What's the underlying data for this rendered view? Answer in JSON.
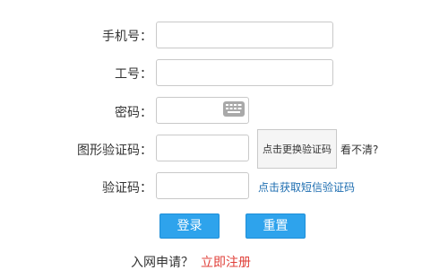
{
  "form": {
    "phone_label": "手机号：",
    "phone_value": "",
    "employee_id_label": "工号：",
    "employee_id_value": "",
    "password_label": "密码：",
    "password_value": "",
    "captcha_label": "图形验证码：",
    "captcha_value": "",
    "captcha_image_text": "点击更换验证码",
    "captcha_refresh_text": "看不清?",
    "sms_label": "验证码：",
    "sms_value": "",
    "sms_link_text": "点击获取短信验证码"
  },
  "buttons": {
    "login_label": "登录",
    "reset_label": "重置"
  },
  "footer": {
    "apply_question": "入网申请？",
    "register_link": "立即注册"
  },
  "colors": {
    "primary_button": "#2ea3ec",
    "link_blue": "#1d6db0",
    "link_red": "#e0403a"
  },
  "icons": {
    "password_keyboard": "keyboard-icon"
  }
}
